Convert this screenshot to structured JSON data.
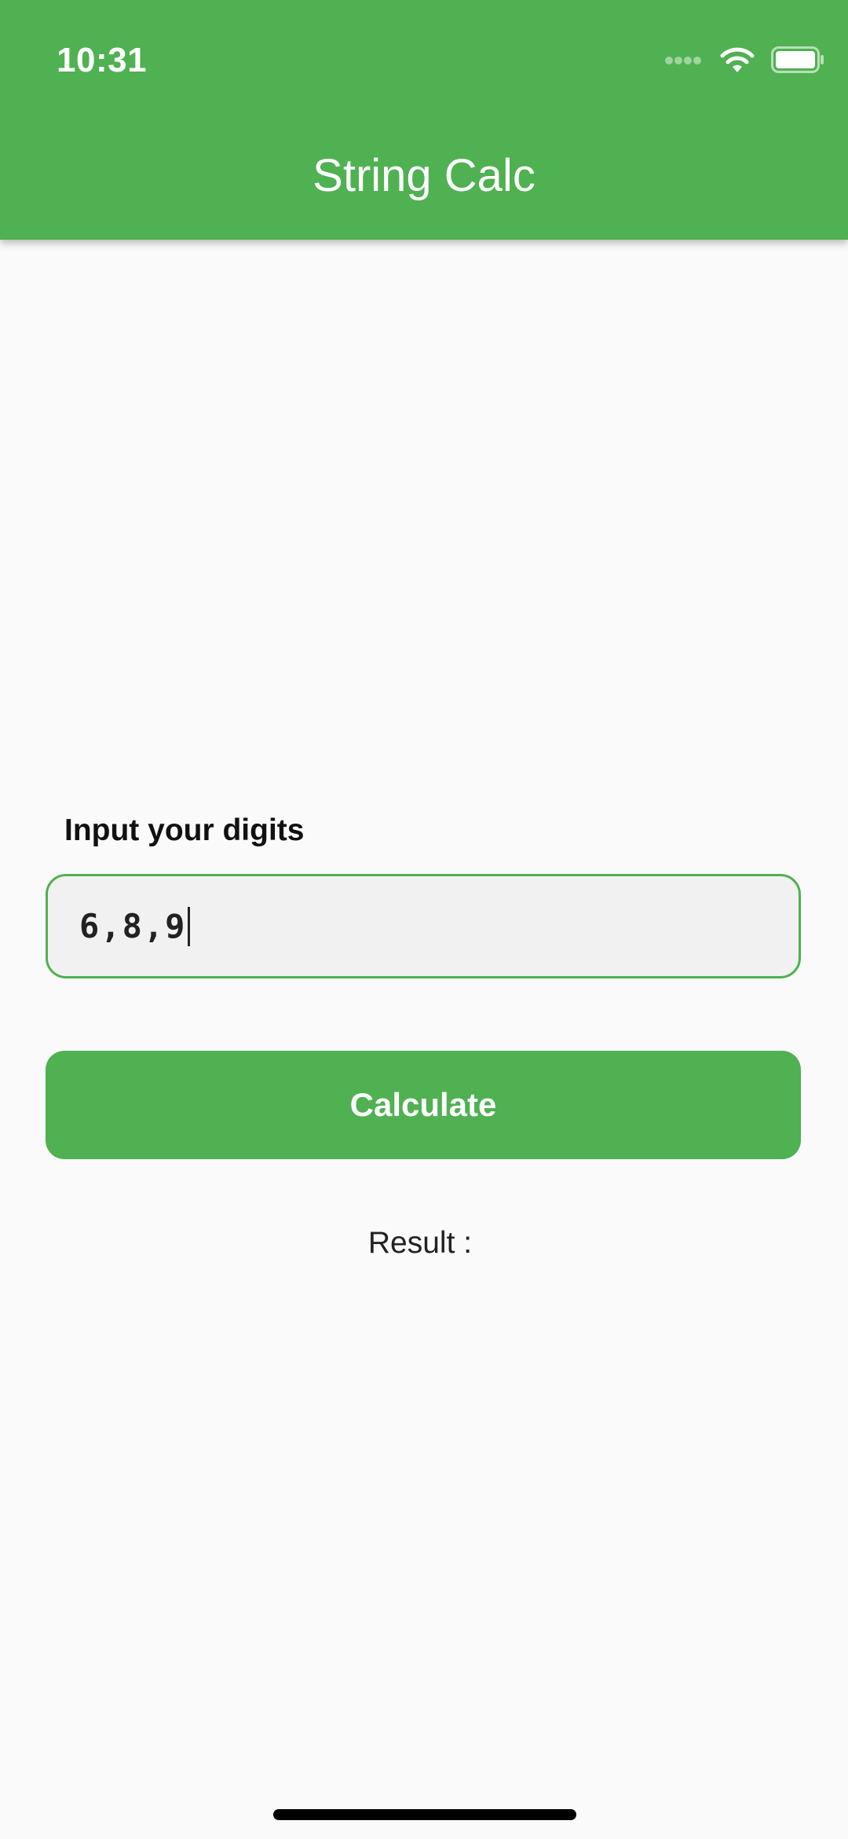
{
  "status_bar": {
    "time": "10:31",
    "signal_icon": "cellular-signal-icon",
    "wifi_icon": "wifi-icon",
    "battery_icon": "battery-icon"
  },
  "app_bar": {
    "title": "String Calc",
    "color": "#4fb151"
  },
  "form": {
    "input_label": "Input your digits",
    "input_value": "6,8,9",
    "button_label": "Calculate",
    "result_label": "Result :"
  }
}
